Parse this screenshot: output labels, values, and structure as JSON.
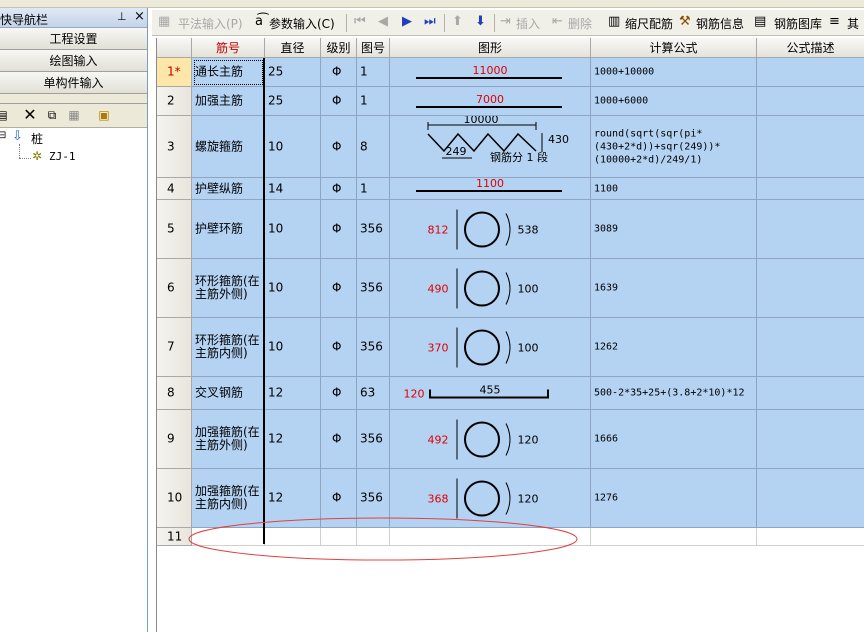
{
  "left_panel": {
    "title": "快导航栏",
    "pin_icon": "pin-icon",
    "close_icon": "close-icon",
    "nav": [
      "工程设置",
      "绘图输入",
      "单构件输入"
    ],
    "tree": {
      "root": "桩",
      "child": "ZJ-1"
    }
  },
  "toolbar": {
    "items": [
      {
        "label": "平法输入(P)",
        "enabled": false
      },
      {
        "label": "参数输入(C)",
        "enabled": true
      },
      {
        "label": "插入",
        "enabled": false
      },
      {
        "label": "删除",
        "enabled": false
      },
      {
        "label": "缩尺配筋",
        "enabled": true
      },
      {
        "label": "钢筋信息",
        "enabled": true
      },
      {
        "label": "钢筋图库",
        "enabled": true
      },
      {
        "label": "其",
        "enabled": true
      }
    ]
  },
  "table": {
    "headers": [
      "筋号",
      "直径(mm)",
      "级别",
      "图号",
      "图形",
      "计算公式",
      "公式描述"
    ],
    "grade_symbol": "Φ",
    "rows": [
      {
        "no": "1*",
        "name": "通长主筋",
        "dia": "25",
        "code": "1",
        "formula": "1000+10000",
        "shape": {
          "kind": "line",
          "value": "11000"
        }
      },
      {
        "no": "2",
        "name": "加强主筋",
        "dia": "25",
        "code": "1",
        "formula": "1000+6000",
        "shape": {
          "kind": "line",
          "value": "7000"
        }
      },
      {
        "no": "3",
        "name": "螺旋箍筋",
        "dia": "10",
        "code": "8",
        "formula": "round(sqrt(sqr(pi*(430+2*d))+sqr(249))*(10000+2*d)/249/1)",
        "shape": {
          "kind": "spiral",
          "length": "10000",
          "pitch": "249",
          "height": "430",
          "note": "钢筋分 1 段"
        }
      },
      {
        "no": "4",
        "name": "护壁纵筋",
        "dia": "14",
        "code": "1",
        "formula": "1100",
        "shape": {
          "kind": "line",
          "value": "1100"
        }
      },
      {
        "no": "5",
        "name": "护壁环筋",
        "dia": "10",
        "code": "356",
        "formula": "3089",
        "shape": {
          "kind": "ring",
          "dia": "812",
          "lap": "538"
        }
      },
      {
        "no": "6",
        "name": "环形箍筋(在主筋外侧)",
        "dia": "10",
        "code": "356",
        "formula": "1639",
        "shape": {
          "kind": "ring",
          "dia": "490",
          "lap": "100"
        }
      },
      {
        "no": "7",
        "name": "环形箍筋(在主筋内侧)",
        "dia": "10",
        "code": "356",
        "formula": "1262",
        "shape": {
          "kind": "ring",
          "dia": "370",
          "lap": "100"
        }
      },
      {
        "no": "8",
        "name": "交叉钢筋",
        "dia": "12",
        "code": "63",
        "formula": "500-2*35+25+(3.8+2*10)*12",
        "shape": {
          "kind": "channel",
          "leg": "120",
          "value": "455"
        }
      },
      {
        "no": "9",
        "name": "加强箍筋(在主筋外侧)",
        "dia": "12",
        "code": "356",
        "formula": "1666",
        "shape": {
          "kind": "ring",
          "dia": "492",
          "lap": "120"
        }
      },
      {
        "no": "10",
        "name": "加强箍筋(在主筋内侧)",
        "dia": "12",
        "code": "356",
        "formula": "1276",
        "shape": {
          "kind": "ring",
          "dia": "368",
          "lap": "120"
        }
      },
      {
        "no": "11",
        "name": "",
        "dia": "",
        "code": "",
        "formula": "",
        "shape": {
          "kind": "none"
        }
      }
    ]
  }
}
